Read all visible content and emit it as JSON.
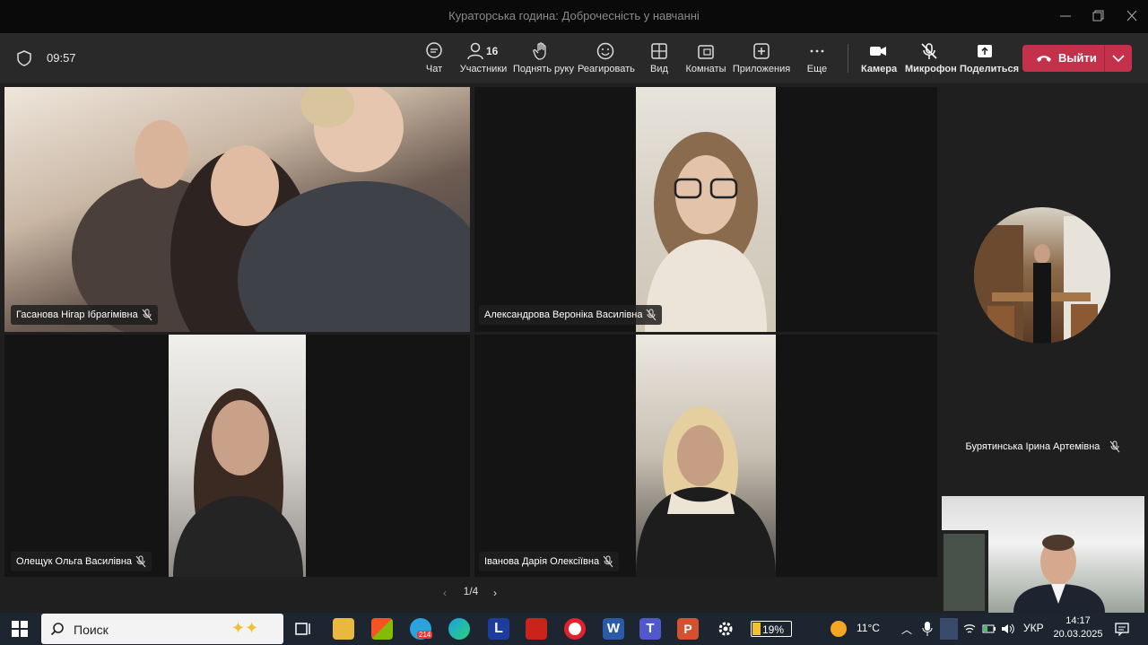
{
  "window": {
    "title": "Кураторська година: Доброчесність у навчанні"
  },
  "meeting": {
    "timer": "09:57",
    "participants_count": "16"
  },
  "toolbar": {
    "chat": "Чат",
    "participants": "Участники",
    "raise_hand": "Поднять руку",
    "react": "Реагировать",
    "view": "Вид",
    "rooms": "Комнаты",
    "apps": "Приложения",
    "more": "Еще",
    "camera": "Камера",
    "mic": "Микрофон",
    "share": "Поделиться",
    "leave": "Выйти"
  },
  "participants": [
    {
      "name": "Гасанова Нігар Ібрагімівна",
      "muted": true
    },
    {
      "name": "Александрова Вероніка Василівна",
      "muted": true
    },
    {
      "name": "Олещук Ольга Василівна",
      "muted": true
    },
    {
      "name": "Іванова Дарія Олексіївна",
      "muted": true
    },
    {
      "name": "Бурятинська Ірина Артемівна",
      "muted": true
    }
  ],
  "pager": {
    "label": "1/4"
  },
  "taskbar": {
    "search_placeholder": "Поиск",
    "telegram_badge": "214",
    "battery": "19%",
    "weather": "11°C",
    "language": "УКР",
    "time": "14:17",
    "date": "20.03.2025"
  },
  "colors": {
    "leave_red": "#c4314b",
    "toolbar_bg": "#292929",
    "stage_bg": "#1f1f1f"
  }
}
